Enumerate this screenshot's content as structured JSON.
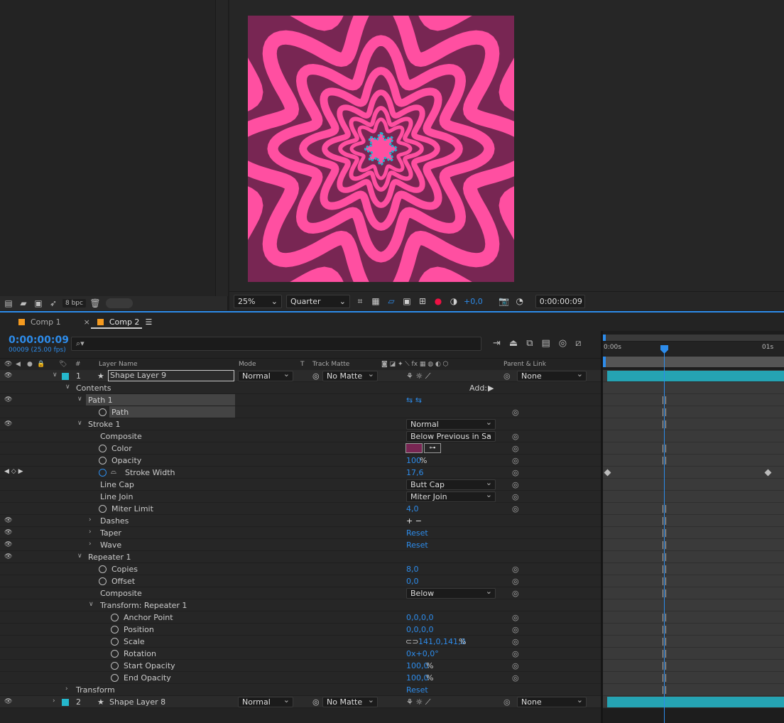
{
  "project": {
    "bpc": "8 bpc"
  },
  "viewer": {
    "zoom": "25%",
    "resolution": "Quarter",
    "exposure": "+0,0",
    "timecode": "0:00:00:09",
    "colors": {
      "dark": "#782653",
      "pink": "#ff4fa1",
      "accent": "#1fb5cf"
    }
  },
  "tabs": [
    {
      "label": "Comp 1"
    },
    {
      "label": "Comp 2"
    }
  ],
  "timeline": {
    "timecode": "0:00:00:09",
    "fps": "00009 (25.00 fps)",
    "search_placeholder": "⌕▾",
    "columns": {
      "hash": "#",
      "layer_name": "Layer Name",
      "mode": "Mode",
      "t": "T",
      "track_matte": "Track Matte",
      "parent": "Parent & Link"
    },
    "ruler": {
      "start": "0:00s",
      "end": "01s"
    }
  },
  "layers": [
    {
      "num": "1",
      "name": "Shape Layer 9",
      "mode": "Normal",
      "matte": "No Matte",
      "parent": "None",
      "color": "#25b7cc"
    },
    {
      "num": "2",
      "name": "Shape Layer 8",
      "mode": "Normal",
      "matte": "No Matte",
      "parent": "None",
      "color": "#25b7cc"
    }
  ],
  "props": {
    "contents": "Contents",
    "add": "Add:",
    "path1": "Path 1",
    "path": "Path",
    "stroke1": "Stroke 1",
    "stroke_mode": "Normal",
    "composite": "Composite",
    "composite_val": "Below Previous in Sa",
    "color": "Color",
    "opacity": "Opacity",
    "opacity_val": "100",
    "percent": "%",
    "stroke_width": "Stroke Width",
    "stroke_width_val": "17,6",
    "line_cap": "Line Cap",
    "line_cap_val": "Butt Cap",
    "line_join": "Line Join",
    "line_join_val": "Miter Join",
    "miter_limit": "Miter Limit",
    "miter_limit_val": "4,0",
    "dashes": "Dashes",
    "taper": "Taper",
    "wave": "Wave",
    "reset": "Reset",
    "repeater1": "Repeater 1",
    "copies": "Copies",
    "copies_val": "8,0",
    "offset": "Offset",
    "offset_val": "0,0",
    "rep_composite_val": "Below",
    "transform_repeater": "Transform: Repeater 1",
    "anchor": "Anchor Point",
    "anchor_val": "0,0,0,0",
    "position": "Position",
    "position_val": "0,0,0,0",
    "scale": "Scale",
    "scale_val": "141,0,141,0",
    "rotation": "Rotation",
    "rotation_val": "0x+0,0°",
    "start_opacity": "Start Opacity",
    "start_opacity_val": "100,0",
    "end_opacity": "End Opacity",
    "end_opacity_val": "100,0",
    "transform": "Transform"
  }
}
